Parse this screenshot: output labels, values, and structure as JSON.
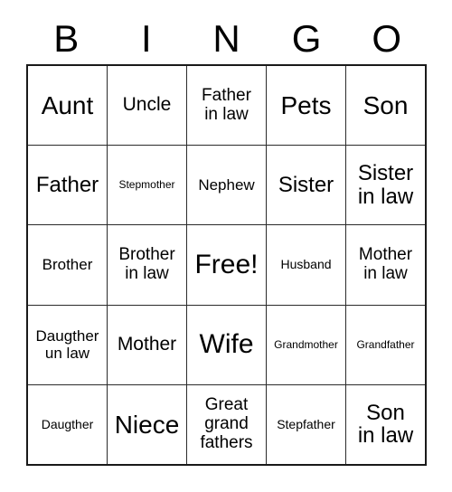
{
  "card": {
    "header": {
      "letters": [
        "B",
        "I",
        "N",
        "G",
        "O"
      ]
    },
    "rows": [
      {
        "cells": [
          {
            "text": "Aunt",
            "size": "fs-xxl"
          },
          {
            "text": "Uncle",
            "size": "fs-l"
          },
          {
            "text": "Father\nin law",
            "size": "fs-ml"
          },
          {
            "text": "Pets",
            "size": "fs-xxl"
          },
          {
            "text": "Son",
            "size": "fs-xxl"
          }
        ]
      },
      {
        "cells": [
          {
            "text": "Father",
            "size": "fs-xl"
          },
          {
            "text": "Stepmother",
            "size": "fs-xs"
          },
          {
            "text": "Nephew",
            "size": "fs-m"
          },
          {
            "text": "Sister",
            "size": "fs-xl"
          },
          {
            "text": "Sister\nin law",
            "size": "fs-xl"
          }
        ]
      },
      {
        "cells": [
          {
            "text": "Brother",
            "size": "fs-m"
          },
          {
            "text": "Brother\nin law",
            "size": "fs-ml"
          },
          {
            "text": "Free!",
            "size": "fs-free"
          },
          {
            "text": "Husband",
            "size": "fs-s"
          },
          {
            "text": "Mother\nin law",
            "size": "fs-ml"
          }
        ]
      },
      {
        "cells": [
          {
            "text": "Daugther\nun law",
            "size": "fs-m"
          },
          {
            "text": "Mother",
            "size": "fs-l"
          },
          {
            "text": "Wife",
            "size": "fs-free"
          },
          {
            "text": "Grandmother",
            "size": "fs-xs"
          },
          {
            "text": "Grandfather",
            "size": "fs-xs"
          }
        ]
      },
      {
        "cells": [
          {
            "text": "Daugther",
            "size": "fs-s"
          },
          {
            "text": "Niece",
            "size": "fs-xxl"
          },
          {
            "text": "Great\ngrand\nfathers",
            "size": "fs-ml"
          },
          {
            "text": "Stepfather",
            "size": "fs-s"
          },
          {
            "text": "Son\nin law",
            "size": "fs-xl"
          }
        ]
      }
    ]
  },
  "colors": {
    "background": "#ffffff",
    "text": "#000000",
    "grid_line": "#2b2b2b",
    "outer_border": "#1a1a1a"
  }
}
